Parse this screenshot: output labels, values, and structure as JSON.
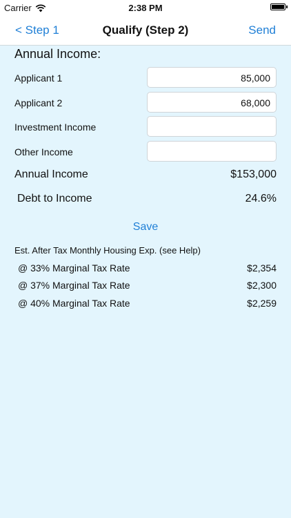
{
  "status_bar": {
    "carrier": "Carrier",
    "time": "2:38 PM",
    "wifi_icon": "wifi-icon",
    "battery_level": 1.0
  },
  "nav": {
    "back_label": "< Step 1",
    "title": "Qualify (Step 2)",
    "send_label": "Send"
  },
  "section_title": "Annual Income:",
  "fields": [
    {
      "label": "Applicant 1",
      "value": "85,000"
    },
    {
      "label": "Applicant 2",
      "value": "68,000"
    },
    {
      "label": "Investment Income",
      "value": ""
    },
    {
      "label": "Other Income",
      "value": ""
    }
  ],
  "totals": {
    "annual_income_label": "Annual Income",
    "annual_income_value": "$153,000",
    "debt_to_income_label": "Debt to Income",
    "debt_to_income_value": "24.6%"
  },
  "save_label": "Save",
  "help_text": "Est. After Tax Monthly Housing Exp. (see Help)",
  "tax_rows": [
    {
      "label": "@ 33% Marginal Tax Rate",
      "value": "$2,354"
    },
    {
      "label": "@ 37% Marginal Tax Rate",
      "value": "$2,300"
    },
    {
      "label": "@ 40% Marginal Tax Rate",
      "value": "$2,259"
    }
  ],
  "colors": {
    "background": "#e3f5fd",
    "accent": "#1f7fd6"
  }
}
